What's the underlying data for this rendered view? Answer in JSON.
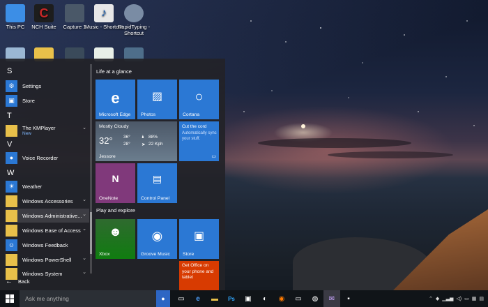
{
  "desktop": {
    "icons": [
      {
        "label": "This PC",
        "icon": "computer-icon",
        "color": "#3c8ee6"
      },
      {
        "label": "NCH Suite",
        "icon": "nch-suite-icon",
        "color": "#c62828"
      },
      {
        "label": "Capture 1",
        "icon": "capture-icon",
        "color": "#4a5868"
      },
      {
        "label": "Music - Shortcut",
        "icon": "music-file-icon",
        "color": "#e7e7e7"
      },
      {
        "label": "RapidTyping - Shortcut",
        "icon": "rapidtyping-icon",
        "color": "#7a8ca4"
      }
    ]
  },
  "start_menu": {
    "letters": {
      "s": "S",
      "t": "T",
      "v": "V",
      "w": "W"
    },
    "apps": {
      "settings": "Settings",
      "store": "Store",
      "kmplayer": "The KMPlayer",
      "kmplayer_badge": "New",
      "voice_recorder": "Voice Recorder",
      "weather": "Weather",
      "accessories": "Windows Accessories",
      "administrative": "Windows Administrative...",
      "ease_of_access": "Windows Ease of Access",
      "feedback": "Windows Feedback",
      "powershell": "Windows PowerShell",
      "system": "Windows System"
    },
    "back_label": "Back",
    "sections": {
      "life": "Life at a glance",
      "play": "Play and explore"
    },
    "tiles": {
      "edge": "Microsoft Edge",
      "photos": "Photos",
      "cortana": "Cortana",
      "weather_condition": "Mostly Cloudy",
      "weather_temp": "32°",
      "weather_high": "36°",
      "weather_low": "28°",
      "weather_humidity": "88%",
      "weather_wind": "22 Kph",
      "weather_location": "Jessore",
      "cutcord_title": "Cut the cord",
      "cutcord_body": "Automatically sync your stuff.",
      "onenote": "OneNote",
      "control_panel": "Control Panel",
      "xbox": "Xbox",
      "groove": "Groove Music",
      "store": "Store",
      "office": "Get Office on your phone and tablet"
    },
    "colors": {
      "tile_blue": "#2b78d4",
      "onenote": "#80397b",
      "office": "#d83b01",
      "xbox": "#107c10"
    }
  },
  "taskbar": {
    "search_placeholder": "Ask me anything"
  }
}
